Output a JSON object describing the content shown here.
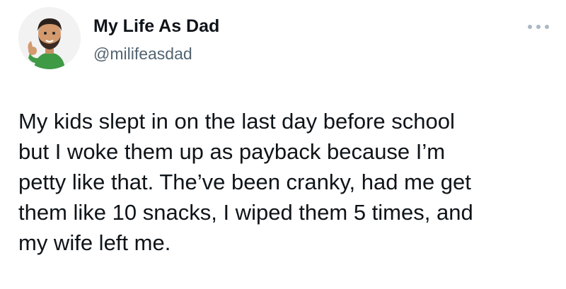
{
  "author": {
    "display_name": "My Life As Dad",
    "handle": "@milifeasdad",
    "avatar_icon": "bitmoji-dad-thumbs-up-avatar"
  },
  "more_menu": {
    "icon": "more-horizontal-icon"
  },
  "tweet": {
    "lines": [
      "My kids slept in on the last day before school",
      "but I woke them up as payback because I’m",
      "petty like that. The’ve been cranky, had me get",
      "them like 10 snacks, I wiped them 5 times, and",
      "my wife left me."
    ]
  },
  "colors": {
    "text": "#0f1419",
    "handle": "#536471",
    "background": "#ffffff",
    "dots": "#aab8c2"
  }
}
